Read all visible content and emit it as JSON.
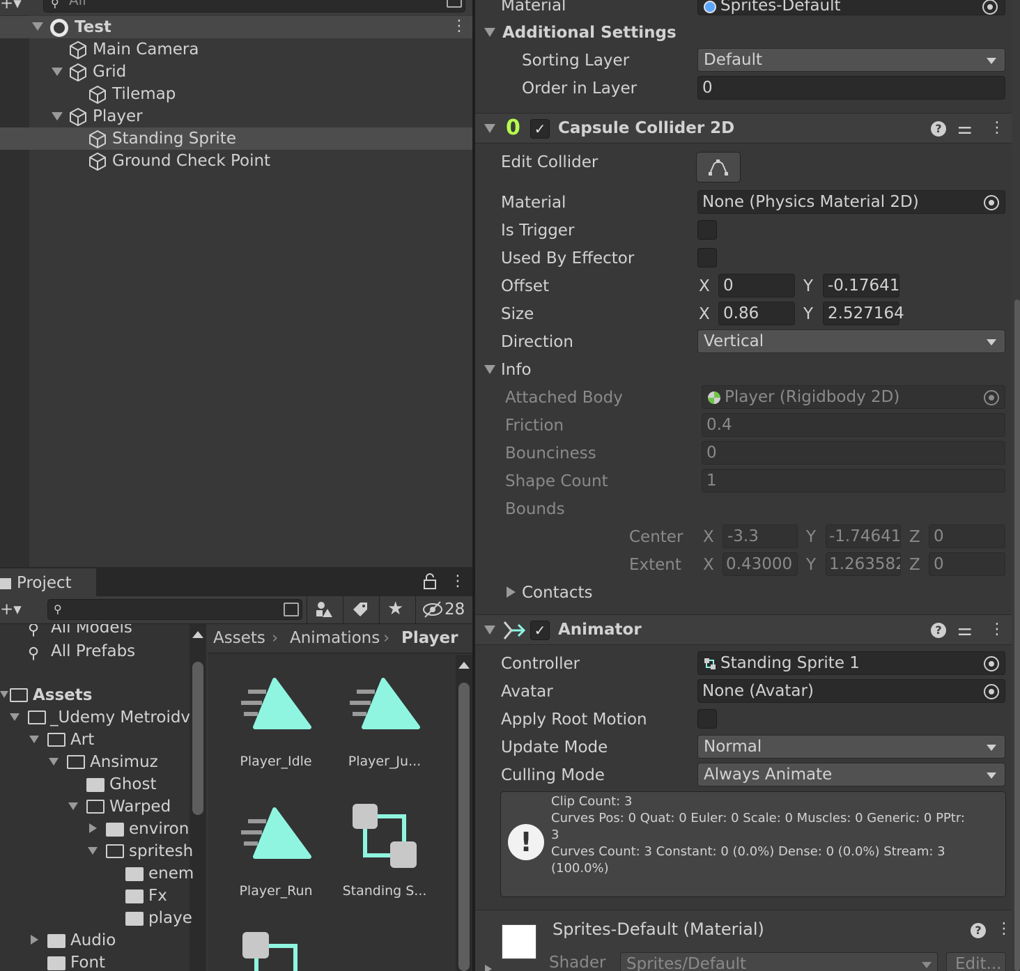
{
  "hierarchy": {
    "search_placeholder": "All",
    "scene_name": "Test",
    "items": [
      {
        "label": "Main Camera"
      },
      {
        "label": "Grid"
      },
      {
        "label": "Tilemap"
      },
      {
        "label": "Player"
      },
      {
        "label": "Standing Sprite"
      },
      {
        "label": "Ground Check Point"
      }
    ]
  },
  "project": {
    "tab_label": "Project",
    "hidden_count": "28",
    "favorites": [
      "All Models",
      "All Prefabs"
    ],
    "tree": [
      {
        "label": "Assets"
      },
      {
        "label": "_Udemy Metroidv"
      },
      {
        "label": "Art"
      },
      {
        "label": "Ansimuz"
      },
      {
        "label": "Ghost"
      },
      {
        "label": "Warped"
      },
      {
        "label": "environ"
      },
      {
        "label": "spritesh"
      },
      {
        "label": "enem"
      },
      {
        "label": "Fx"
      },
      {
        "label": "playe"
      },
      {
        "label": "Audio"
      },
      {
        "label": "Font"
      }
    ],
    "breadcrumb": [
      "Assets",
      "Animations",
      "Player"
    ],
    "assets": [
      {
        "label": "Player_Idle",
        "kind": "animation-clip-icon"
      },
      {
        "label": "Player_Ju...",
        "kind": "animation-clip-icon"
      },
      {
        "label": "Player_Run",
        "kind": "animation-clip-icon"
      },
      {
        "label": "Standing S...",
        "kind": "animator-controller-icon"
      }
    ]
  },
  "inspector": {
    "renderer": {
      "material_label": "Material",
      "material_value": "Sprites-Default",
      "additional_settings": "Additional Settings",
      "sorting_layer_label": "Sorting Layer",
      "sorting_layer_value": "Default",
      "order_label": "Order in Layer",
      "order_value": "0"
    },
    "collider": {
      "title": "Capsule Collider 2D",
      "edit_collider_label": "Edit Collider",
      "material_label": "Material",
      "material_value": "None (Physics Material 2D)",
      "is_trigger_label": "Is Trigger",
      "used_by_effector_label": "Used By Effector",
      "offset_label": "Offset",
      "offset_x": "0",
      "offset_y": "-0.17641",
      "size_label": "Size",
      "size_x": "0.86",
      "size_y": "2.527164",
      "x_label": "X",
      "y_label": "Y",
      "z_label": "Z",
      "direction_label": "Direction",
      "direction_value": "Vertical",
      "info_label": "Info",
      "attached_body_label": "Attached Body",
      "attached_body_value": "Player (Rigidbody 2D)",
      "friction_label": "Friction",
      "friction_value": "0.4",
      "bounciness_label": "Bounciness",
      "bounciness_value": "0",
      "shape_count_label": "Shape Count",
      "shape_count_value": "1",
      "bounds_label": "Bounds",
      "center_label": "Center",
      "center_x": "-3.3",
      "center_y": "-1.74641",
      "center_z": "0",
      "extent_label": "Extent",
      "extent_x": "0.43000",
      "extent_y": "1.263582",
      "extent_z": "0",
      "contacts_label": "Contacts"
    },
    "animator": {
      "title": "Animator",
      "controller_label": "Controller",
      "controller_value": "Standing Sprite 1",
      "avatar_label": "Avatar",
      "avatar_value": "None (Avatar)",
      "apply_root_motion_label": "Apply Root Motion",
      "update_mode_label": "Update Mode",
      "update_mode_value": "Normal",
      "culling_mode_label": "Culling Mode",
      "culling_mode_value": "Always Animate",
      "info_lines": [
        "Clip Count: 3",
        "Curves Pos: 0 Quat: 0 Euler: 0 Scale: 0 Muscles: 0 Generic: 0 PPtr:",
        "3",
        "Curves Count: 3 Constant: 0 (0.0%) Dense: 0 (0.0%) Stream: 3",
        "(100.0%)"
      ]
    },
    "material_asset": {
      "title": "Sprites-Default (Material)",
      "shader_label": "Shader",
      "shader_value": "Sprites/Default",
      "edit_label": "Edit..."
    }
  },
  "colors": {
    "accent_teal": "#8ff5e0",
    "enabled_toggle": "#b6ff4d",
    "panel_bg": "#383838"
  }
}
